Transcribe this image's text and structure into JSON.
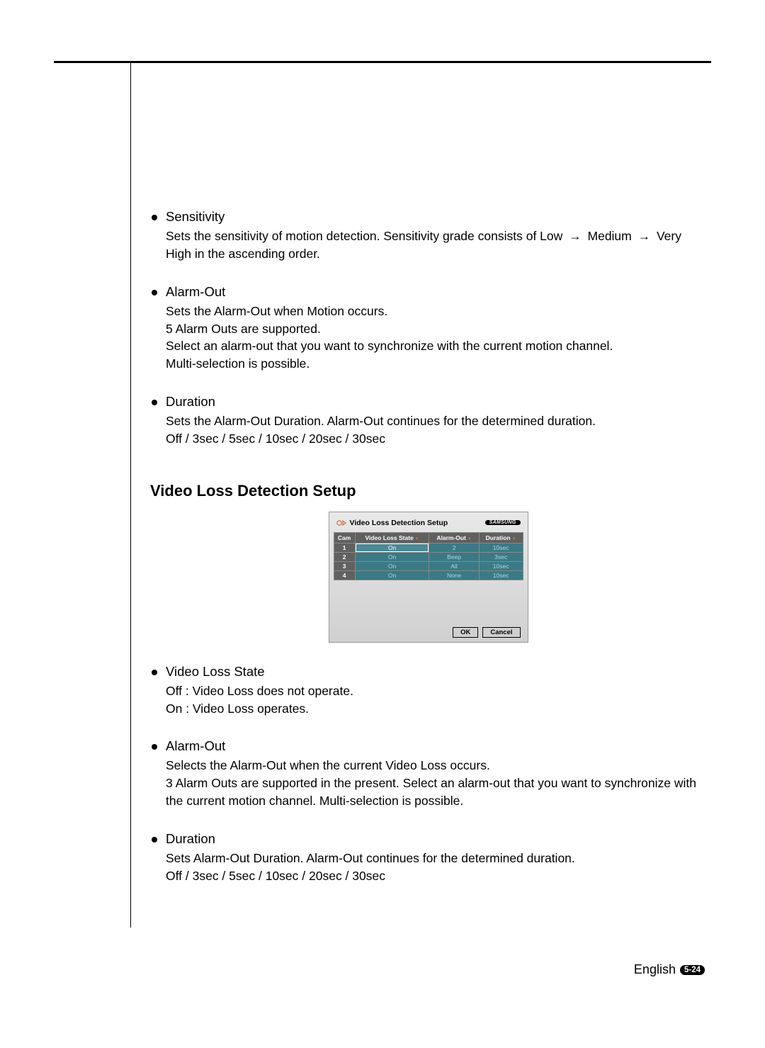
{
  "sections": {
    "sensitivity": {
      "title": "Sensitivity",
      "body_pre": "Sets the sensitivity of motion detection. Sensitivity grade consists of Low ",
      "body_mid1": " Medium ",
      "body_mid2": " Very High in the ascending order."
    },
    "alarm_out_1": {
      "title": "Alarm-Out",
      "lines": [
        "Sets the Alarm-Out when Motion occurs.",
        "5 Alarm Outs are supported.",
        "Select an alarm-out that you want to synchronize with the current motion channel.",
        "Multi-selection is possible."
      ]
    },
    "duration_1": {
      "title": "Duration",
      "lines": [
        "Sets the Alarm-Out Duration. Alarm-Out continues for the determined duration.",
        "Off / 3sec / 5sec / 10sec / 20sec / 30sec"
      ]
    },
    "video_loss_state": {
      "title": "Video Loss State",
      "lines": [
        "Off : Video Loss does not operate.",
        "On : Video Loss operates."
      ]
    },
    "alarm_out_2": {
      "title": "Alarm-Out",
      "lines": [
        "Selects the Alarm-Out when the current Video Loss occurs.",
        "3 Alarm Outs are supported in the present. Select an alarm-out that you want to synchronize with the current motion channel. Multi-selection is possible."
      ]
    },
    "duration_2": {
      "title": "Duration",
      "lines": [
        "Sets Alarm-Out Duration. Alarm-Out continues for the determined duration.",
        "Off / 3sec / 5sec / 10sec / 20sec / 30sec"
      ]
    }
  },
  "heading2": "Video Loss Detection Setup",
  "dialog": {
    "title": "Video Loss Detection Setup",
    "brand": "SAMSUNG",
    "columns": [
      "Cam",
      "Video Loss State",
      "Alarm-Out",
      "Duration"
    ],
    "rows": [
      {
        "cam": "1",
        "state": "On",
        "alarm": "2",
        "dur": "10sec",
        "selected": true
      },
      {
        "cam": "2",
        "state": "On",
        "alarm": "Beep",
        "dur": "3sec",
        "selected": false
      },
      {
        "cam": "3",
        "state": "On",
        "alarm": "All",
        "dur": "10sec",
        "selected": false
      },
      {
        "cam": "4",
        "state": "On",
        "alarm": "None",
        "dur": "10sec",
        "selected": false
      }
    ],
    "ok": "OK",
    "cancel": "Cancel"
  },
  "footer": {
    "lang": "English",
    "page": "5-24"
  },
  "arrow": "→"
}
